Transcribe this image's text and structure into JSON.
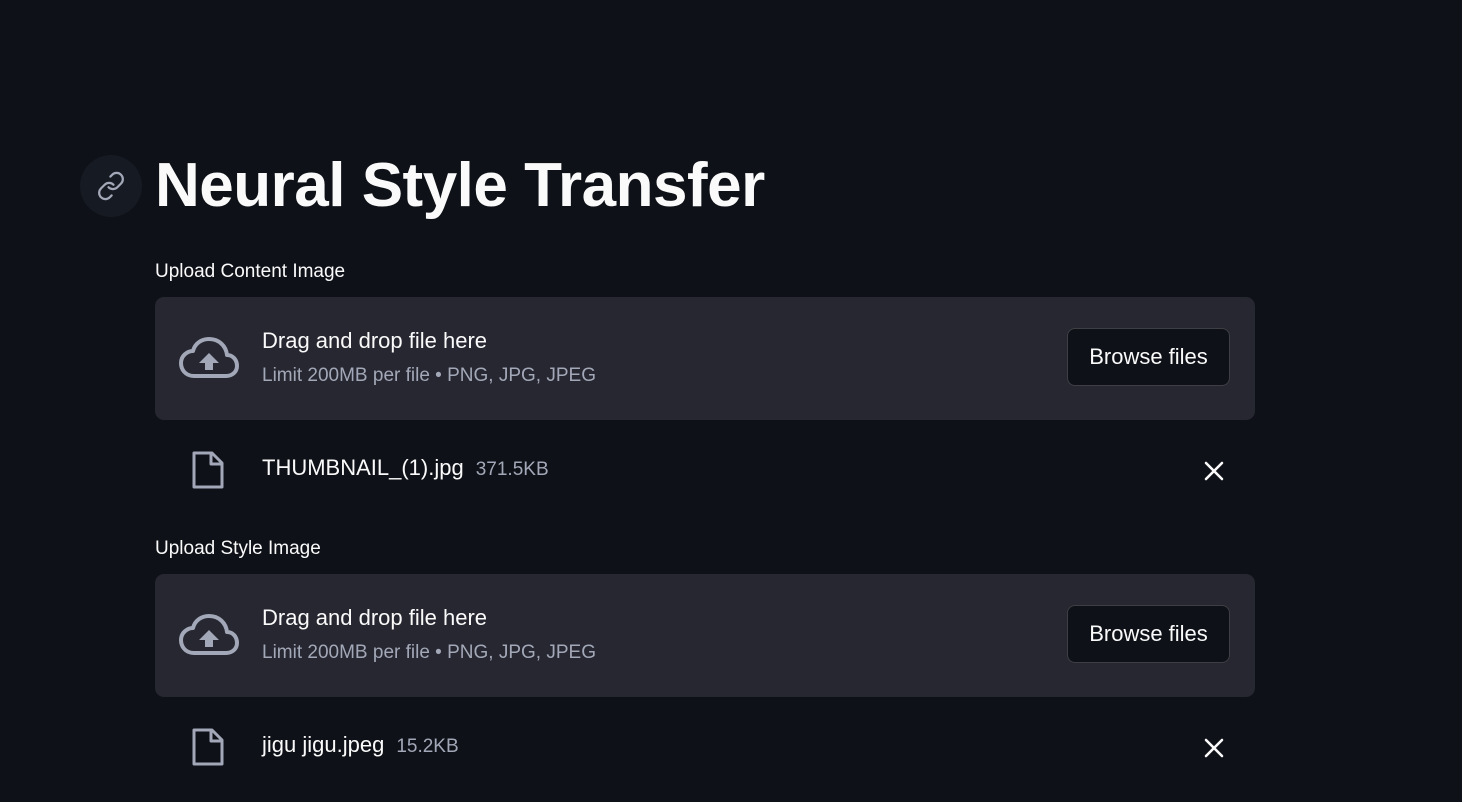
{
  "header": {
    "title": "Neural Style Transfer",
    "anchor_icon": "link-icon"
  },
  "uploaders": [
    {
      "label": "Upload Content Image",
      "dropzone_text": "Drag and drop file here",
      "dropzone_limits": "Limit 200MB per file • PNG, JPG, JPEG",
      "browse_label": "Browse files",
      "file": {
        "name": "THUMBNAIL_(1).jpg",
        "size": "371.5KB"
      }
    },
    {
      "label": "Upload Style Image",
      "dropzone_text": "Drag and drop file here",
      "dropzone_limits": "Limit 200MB per file • PNG, JPG, JPEG",
      "browse_label": "Browse files",
      "file": {
        "name": "jigu jigu.jpeg",
        "size": "15.2KB"
      }
    }
  ],
  "colors": {
    "background": "#0e1117",
    "dropzone": "#262730",
    "text": "#fafafa",
    "muted": "#a3a8b8"
  }
}
